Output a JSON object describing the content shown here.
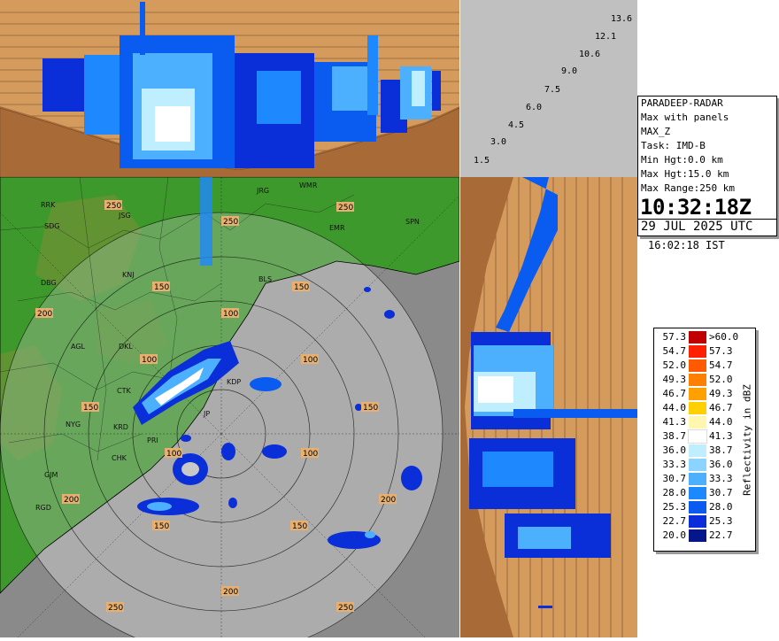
{
  "info": {
    "station": "PARADEEP-RADAR",
    "product": "Max with panels",
    "product_code": "MAX_Z",
    "task": "Task: IMD-B",
    "min_hgt": "Min Hgt:0.0 km",
    "max_hgt": "Max Hgt:15.0 km",
    "max_range": "Max Range:250 km",
    "time_utc": "10:32:18Z",
    "date_utc": "29 JUL 2025 UTC",
    "time_ist": "16:02:18 IST"
  },
  "elevation_angles": [
    "1.5",
    "3.0",
    "4.5",
    "6.0",
    "7.5",
    "9.0",
    "10.6",
    "12.1",
    "13.6"
  ],
  "range_rings": {
    "top_left": "250",
    "inner_1": "150",
    "inner_2": "100",
    "east_1": "100",
    "east_2": "150",
    "east_3": "150",
    "east_4": "200",
    "south_1": "100",
    "south_2": "150",
    "south_3": "200",
    "south_4": "250",
    "sw_1": "150",
    "sw_2": "200",
    "sw_3": "250",
    "north_1": "250",
    "ne_1": "250",
    "ne_2": "150",
    "center": "100",
    "west_150": "150",
    "west_200": "200",
    "west_100": "100",
    "se_250": "250"
  },
  "places": [
    "RRK",
    "SDG",
    "JSG",
    "KNJ",
    "DBG",
    "AGL",
    "DKL",
    "CTK",
    "NYG",
    "KRD",
    "PRI",
    "CHK",
    "GJM",
    "RGD",
    "JRG",
    "WMR",
    "EMR",
    "BLS",
    "SPN",
    "KDP",
    "JP"
  ],
  "legend": {
    "title": "Reflectivity in dBZ",
    "rows": [
      {
        "lo": "57.3",
        "hi": ">60.0",
        "color": "#c00000"
      },
      {
        "lo": "54.7",
        "hi": "57.3",
        "color": "#ff2000"
      },
      {
        "lo": "52.0",
        "hi": "54.7",
        "color": "#ff5a00"
      },
      {
        "lo": "49.3",
        "hi": "52.0",
        "color": "#ff7f00"
      },
      {
        "lo": "46.7",
        "hi": "49.3",
        "color": "#ffa000"
      },
      {
        "lo": "44.0",
        "hi": "46.7",
        "color": "#ffd000"
      },
      {
        "lo": "41.3",
        "hi": "44.0",
        "color": "#fff6b0"
      },
      {
        "lo": "38.7",
        "hi": "41.3",
        "color": "#ffffff"
      },
      {
        "lo": "36.0",
        "hi": "38.7",
        "color": "#bfeeff"
      },
      {
        "lo": "33.3",
        "hi": "36.0",
        "color": "#8ad4ff"
      },
      {
        "lo": "30.7",
        "hi": "33.3",
        "color": "#4db0ff"
      },
      {
        "lo": "28.0",
        "hi": "30.7",
        "color": "#1e88ff"
      },
      {
        "lo": "25.3",
        "hi": "28.0",
        "color": "#0a5cf0"
      },
      {
        "lo": "22.7",
        "hi": "25.3",
        "color": "#0a2fd8"
      },
      {
        "lo": "20.0",
        "hi": "22.7",
        "color": "#05168a"
      }
    ]
  },
  "colors": {
    "panel_bg": "#d59b5c",
    "panel_dark": "#a86b38",
    "sea": "#c8c8c8",
    "land": "#3e9a2c",
    "highland": "#8c8c3a"
  }
}
